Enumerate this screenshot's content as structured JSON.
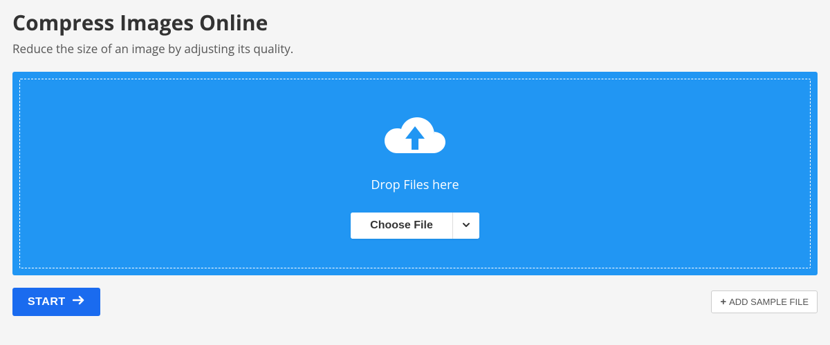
{
  "header": {
    "title": "Compress Images Online",
    "subtitle": "Reduce the size of an image by adjusting its quality."
  },
  "dropzone": {
    "drop_label": "Drop Files here",
    "choose_file_label": "Choose File"
  },
  "actions": {
    "start_label": "START",
    "add_sample_label": "ADD SAMPLE FILE"
  }
}
